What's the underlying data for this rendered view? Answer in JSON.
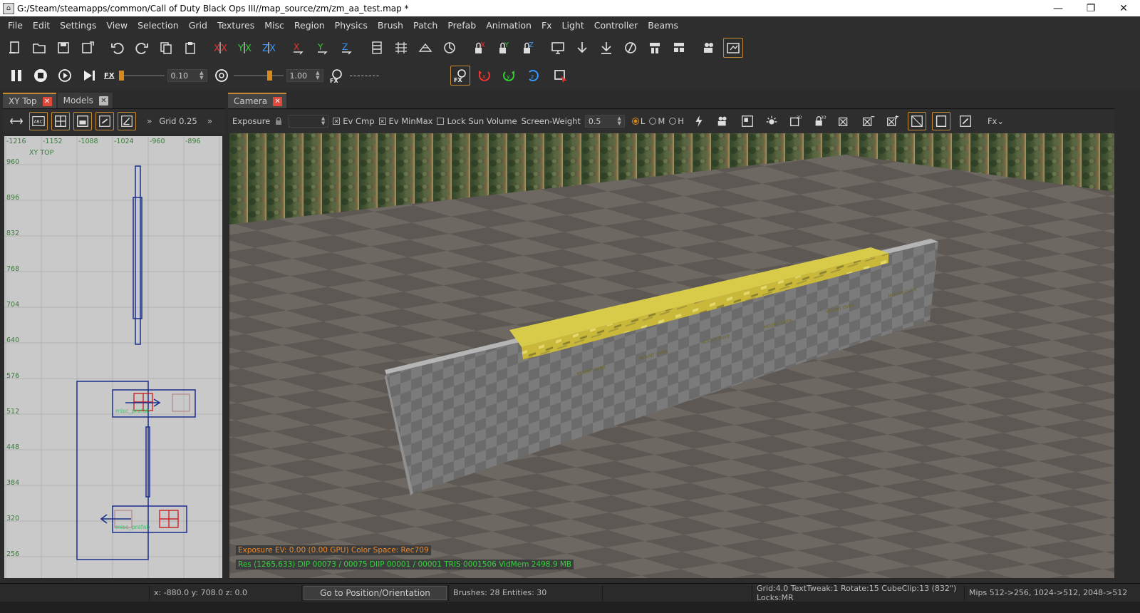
{
  "window": {
    "title": "G:/Steam/steamapps/common/Call of Duty Black Ops III//map_source/zm/zm_aa_test.map *",
    "minimize": "—",
    "restore": "❐",
    "close": "✕"
  },
  "menu": [
    "File",
    "Edit",
    "Settings",
    "View",
    "Selection",
    "Grid",
    "Textures",
    "Misc",
    "Region",
    "Physics",
    "Brush",
    "Patch",
    "Prefab",
    "Animation",
    "Fx",
    "Light",
    "Controller",
    "Beams"
  ],
  "toolbar2": {
    "fx_label": "FX",
    "speed_value": "0.10",
    "time_value": "1.00",
    "dashes": "--------",
    "speed_level": 0.0,
    "time_level": 0.75
  },
  "left_panel": {
    "tabs": [
      {
        "label": "XY Top",
        "close": "✕"
      },
      {
        "label": "Models",
        "close": "✕"
      }
    ],
    "grid_label": "Grid 0.25",
    "more": "»",
    "view_label": "XY TOP",
    "x_ticks": [
      "-1216",
      "-1152",
      "-1088",
      "-1024",
      "-960",
      "-896"
    ],
    "y_ticks": [
      "960",
      "896",
      "832",
      "768",
      "704",
      "640",
      "576",
      "512",
      "448",
      "384",
      "320",
      "256"
    ],
    "entity_labels": [
      "misc_prefab",
      "misc_prefab"
    ]
  },
  "camera_panel": {
    "tab": {
      "label": "Camera",
      "close": "✕"
    },
    "exposure_label": "Exposure",
    "ev_cmp_label": "Ev Cmp",
    "ev_minmax_label": "Ev MinMax",
    "lock_sun_label": "Lock Sun Volume",
    "screen_weight_label": "Screen-Weight",
    "screen_weight_value": "0.5",
    "lod": [
      "L",
      "M",
      "H"
    ],
    "fx_label": "Fx"
  },
  "viewport": {
    "overlay_exposure": "Exposure EV: 0.00 (0.00 GPU)  Color Space: Rec709",
    "overlay_stats": "Res (1265,633)   DIP 00073 / 00075  DIIP 00001 / 00001  TRIS 0001506  VidMem 2498.9 MB",
    "decal_text": "MOUNT OVER"
  },
  "status": {
    "coords": "x: -880.0  y: 708.0  z: 0.0",
    "goto": "Go to Position/Orientation",
    "counts": "Brushes: 28 Entities: 30",
    "settings": "Grid:4.0 TextTweak:1 Rotate:15 CubeClip:13 (832\") Locks:MR",
    "mips": "Mips 512->256, 1024->512, 2048->512"
  },
  "colors": {
    "accent": "#c88a30",
    "close_red": "#e0493c",
    "overlay_orange": "#e88a2e",
    "overlay_green": "#35d13c",
    "brush_blue": "#1a2f8c"
  }
}
